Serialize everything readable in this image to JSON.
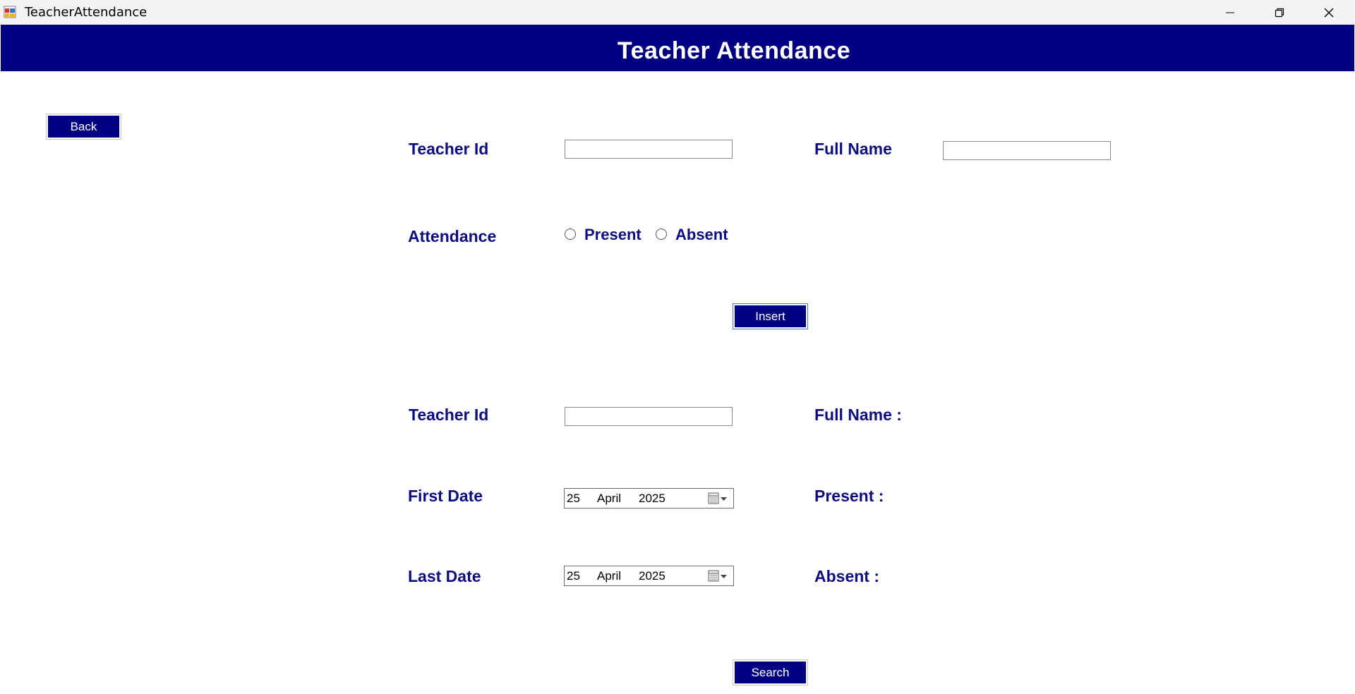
{
  "window": {
    "title": "TeacherAttendance"
  },
  "header": {
    "title": "Teacher Attendance",
    "background": "#000080"
  },
  "buttons": {
    "back": "Back",
    "insert": "Insert",
    "search": "Search"
  },
  "insert_form": {
    "teacher_id_label": "Teacher Id",
    "teacher_id_value": "",
    "full_name_label": "Full Name",
    "full_name_value": "",
    "attendance_label": "Attendance",
    "present_option": "Present",
    "absent_option": "Absent",
    "selected_option": null
  },
  "search_form": {
    "teacher_id_label": "Teacher Id",
    "teacher_id_value": "",
    "full_name_label": "Full Name :",
    "first_date_label": "First Date",
    "last_date_label": "Last Date",
    "present_label": "Present :",
    "absent_label": "Absent :",
    "first_date": {
      "day": "25",
      "month": "April",
      "year": "2025"
    },
    "last_date": {
      "day": "25",
      "month": "April",
      "year": "2025"
    }
  },
  "colors": {
    "accent": "#000080",
    "label_text": "#0d0d7f"
  }
}
